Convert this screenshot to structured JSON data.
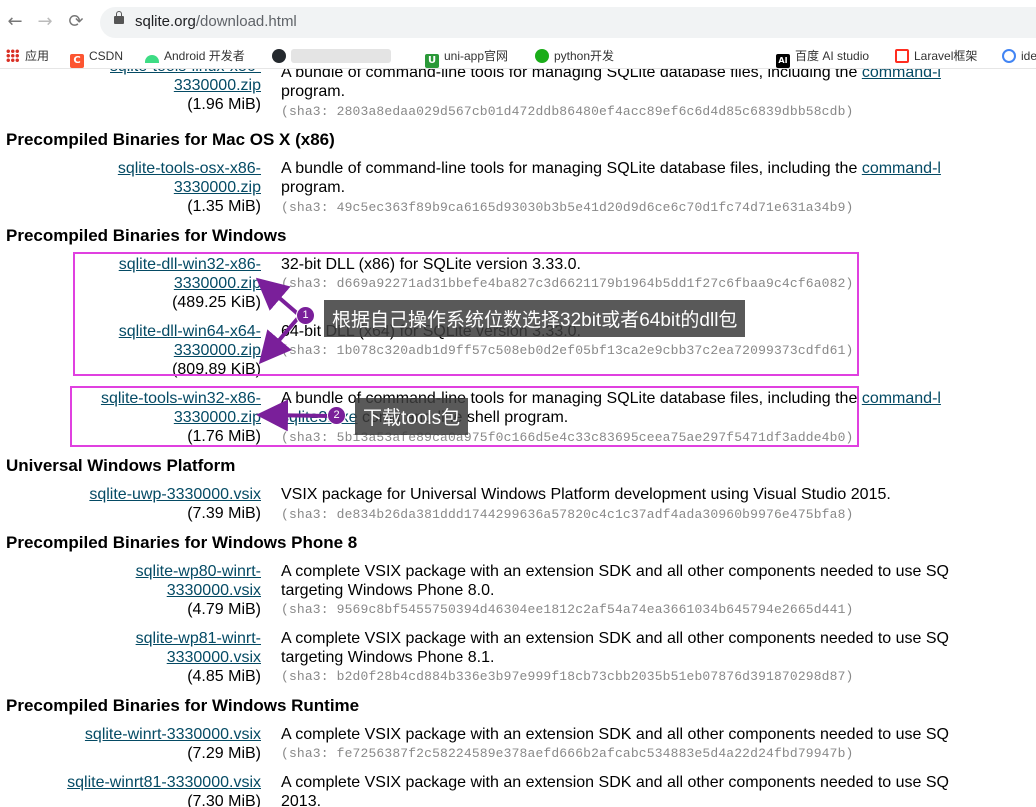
{
  "browser": {
    "url_host": "sqlite.org",
    "url_path": "/download.html",
    "nav": {
      "back": "←",
      "forward": "→",
      "reload": "⟳"
    },
    "bookmarks": [
      {
        "label": "应用",
        "icon": "apps-icon",
        "color": "#d93025"
      },
      {
        "label": "CSDN",
        "icon": "csdn-icon",
        "color": "#fc5531",
        "glyph": "C"
      },
      {
        "label": "Android 开发者",
        "icon": "android-icon",
        "color": "#3ddc84"
      },
      {
        "label": "",
        "icon": "github-icon",
        "color": "#24292e"
      },
      {
        "label": "uni-app官网",
        "icon": "uniapp-icon",
        "color": "#2b9939",
        "glyph": "U"
      },
      {
        "label": "python开发",
        "icon": "wechat-icon",
        "color": "#1aad19"
      },
      {
        "label": "百度 AI studio",
        "icon": "ai-studio-icon",
        "color": "#000000",
        "glyph": "AI"
      },
      {
        "label": "Laravel框架",
        "icon": "laravel-icon",
        "color": "#ff2d20"
      },
      {
        "label": "ide",
        "icon": "ide-icon",
        "color": "#4285f4"
      }
    ]
  },
  "sections": {
    "linux_top": {
      "file_line2": "3330000.zip",
      "size": "(1.96 MiB)",
      "desc": "A bundle of command-line tools for managing SQLite database files, including the",
      "desc_link": "command-l",
      "sha": "(sha3: 2803a8edaa029d567cb01d472ddb86480ef4acc89ef6c6d4d85c6839dbb58cdb)"
    },
    "mac": {
      "heading": "Precompiled Binaries for Mac OS X (x86)",
      "file_line1": "sqlite-tools-osx-x86-",
      "file_line2": "3330000.zip",
      "size": "(1.35 MiB)",
      "desc": "A bundle of command-line tools for managing SQLite database files, including the",
      "desc_link": "command-l",
      "desc2": "program.",
      "sha": "(sha3: 49c5ec363f89b9ca6165d93030b3b5e41d20d9d6ce6c70d1fc74d71e631a34b9)"
    },
    "windows": {
      "heading": "Precompiled Binaries for Windows",
      "dll32": {
        "file_line1": "sqlite-dll-win32-x86-",
        "file_line2": "3330000.zip",
        "size": "(489.25 KiB)",
        "desc": "32-bit DLL (x86) for SQLite version 3.33.0.",
        "sha": "(sha3: d669a92271ad31bbefe4ba827c3d6621179b1964b5dd1f27c6fbaa9c4cf6a082)"
      },
      "dll64": {
        "file_line1": "sqlite-dll-win64-x64-",
        "file_line2": "3330000.zip",
        "size": "(809.89 KiB)",
        "desc": "64-bit DLL (x64) for SQLite version 3.33.0.",
        "sha": "(sha3: 1b078c320adb1d9ff57c508eb0d2ef05bf13ca2e9cbb37c2ea72099373cdfd61)"
      },
      "tools": {
        "file_line1": "sqlite-tools-win32-x86-",
        "file_line2": "3330000.zip",
        "size": "(1.76 MiB)",
        "desc": "A bundle of command-line tools for managing SQLite database files, including the",
        "desc_link": "command-l",
        "desc2_link": "sqlite3.exe",
        "desc2": " command-line shell program.",
        "sha": "(sha3: 5b13a53afe89ca0a975f0c166d5e4c33c83695ceea75ae297f5471df3adde4b0)"
      }
    },
    "uwp": {
      "heading": "Universal Windows Platform",
      "file_line1": "sqlite-uwp-3330000.vsix",
      "size": "(7.39 MiB)",
      "desc": "VSIX package for Universal Windows Platform development using Visual Studio 2015.",
      "sha": "(sha3: de834b26da381ddd1744299636a57820c4c1c37adf4ada30960b9976e475bfa8)"
    },
    "wp8": {
      "heading": "Precompiled Binaries for Windows Phone 8",
      "wp80": {
        "file_line1": "sqlite-wp80-winrt-",
        "file_line2": "3330000.vsix",
        "size": "(4.79 MiB)",
        "desc": "A complete VSIX package with an extension SDK and all other components needed to use SQ",
        "desc2": "targeting Windows Phone 8.0.",
        "sha": "(sha3: 9569c8bf5455750394d46304ee1812c2af54a74ea3661034b645794e2665d441)"
      },
      "wp81": {
        "file_line1": "sqlite-wp81-winrt-",
        "file_line2": "3330000.vsix",
        "size": "(4.85 MiB)",
        "desc": "A complete VSIX package with an extension SDK and all other components needed to use SQ",
        "desc2": "targeting Windows Phone 8.1.",
        "sha": "(sha3: b2d0f28b4cd884b336e3b97e999f18cb73cbb2035b51eb07876d391870298d87)"
      }
    },
    "winrt": {
      "heading": "Precompiled Binaries for Windows Runtime",
      "winrt": {
        "file_line1": "sqlite-winrt-3330000.vsix",
        "size": "(7.29 MiB)",
        "desc": "A complete VSIX package with an extension SDK and all other components needed to use SQ",
        "sha": "(sha3: fe7256387f2c58224589e378aefd666b2afcabc534883e5d4a22d24fbd79947b)"
      },
      "winrt81": {
        "file_line1": "sqlite-winrt81-3330000.vsix",
        "size": "(7.30 MiB)",
        "desc": "A complete VSIX package with an extension SDK and all other components needed to use SQ",
        "desc2": "2013."
      }
    }
  },
  "annotations": {
    "callout1": {
      "num": "1",
      "text": "根据自己操作系统位数选择32bit或者64bit的dll包"
    },
    "callout2": {
      "num": "2",
      "text": "下载tools包"
    },
    "highlight_color": "#e040e0",
    "arrow_color": "#7a1f9a"
  }
}
